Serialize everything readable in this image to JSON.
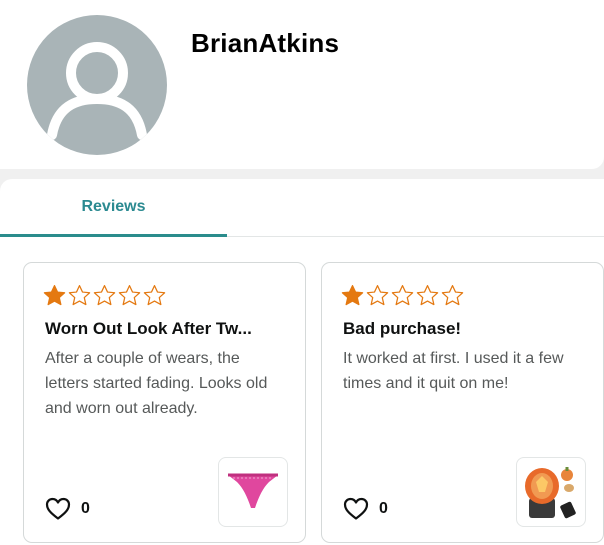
{
  "profile": {
    "username": "BrianAtkins"
  },
  "tabs": [
    {
      "label": "Reviews"
    }
  ],
  "reviews": [
    {
      "rating": 1,
      "rating_max": 5,
      "title": "Worn Out Look After Tw...",
      "body": "After a couple of wears, the letters started fading. Looks old and worn out already.",
      "likes": "0",
      "product_icon": "pink-thong-product-image"
    },
    {
      "rating": 1,
      "rating_max": 5,
      "title": "Bad purchase!",
      "body": "It worked at first. I used it a few times and it quit on me!",
      "likes": "0",
      "product_icon": "orange-pumpkin-lamp-product-image"
    }
  ],
  "colors": {
    "star": "#e47911",
    "tab_accent": "#2a8c8c",
    "avatar_bg": "#a9b4b7"
  }
}
